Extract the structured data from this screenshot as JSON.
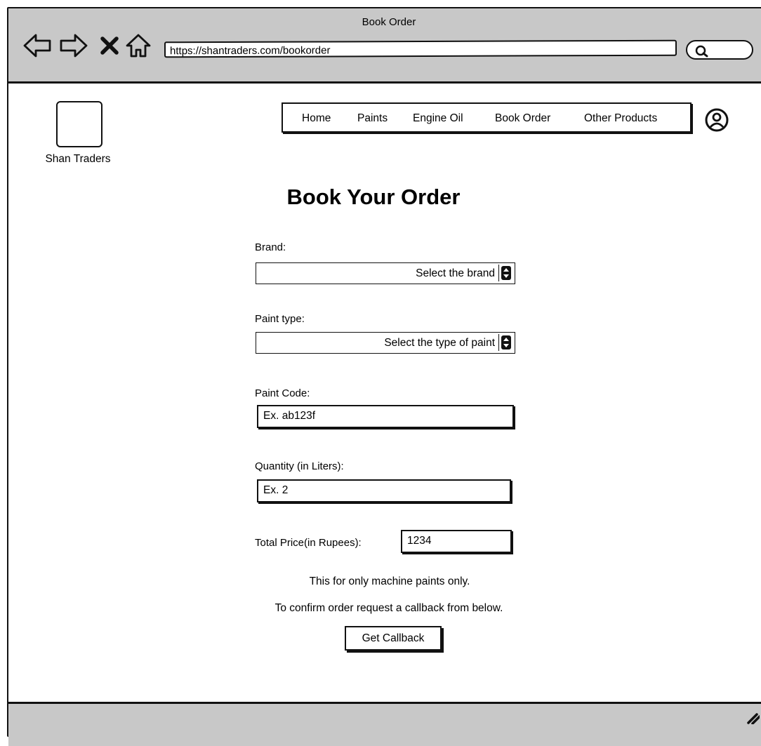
{
  "window": {
    "title": "Book Order"
  },
  "browser": {
    "url": "https://shantraders.com/bookorder",
    "icons": [
      "back-arrow-icon",
      "forward-arrow-icon",
      "close-x-icon",
      "home-icon",
      "search-icon"
    ]
  },
  "brand": {
    "name": "Shan Traders"
  },
  "nav": {
    "items": [
      "Home",
      "Paints",
      "Engine Oil",
      "Book Order",
      "Other Products"
    ],
    "profile_icon": "user-circle-icon"
  },
  "form": {
    "heading": "Book Your Order",
    "brand_label": "Brand:",
    "brand_value": "Select the brand",
    "paint_type_label": "Paint type:",
    "paint_type_value": "Select the type of paint",
    "paint_code_label": "Paint Code:",
    "paint_code_value": "Ex. ab123f",
    "quantity_label": "Quantity (in Liters):",
    "quantity_value": "Ex. 2",
    "total_label": "Total Price(in Rupees):",
    "total_value": "1234",
    "note_1": "This for only machine paints only.",
    "note_2": "To confirm order request a callback from below.",
    "callback_label": "Get Callback"
  }
}
